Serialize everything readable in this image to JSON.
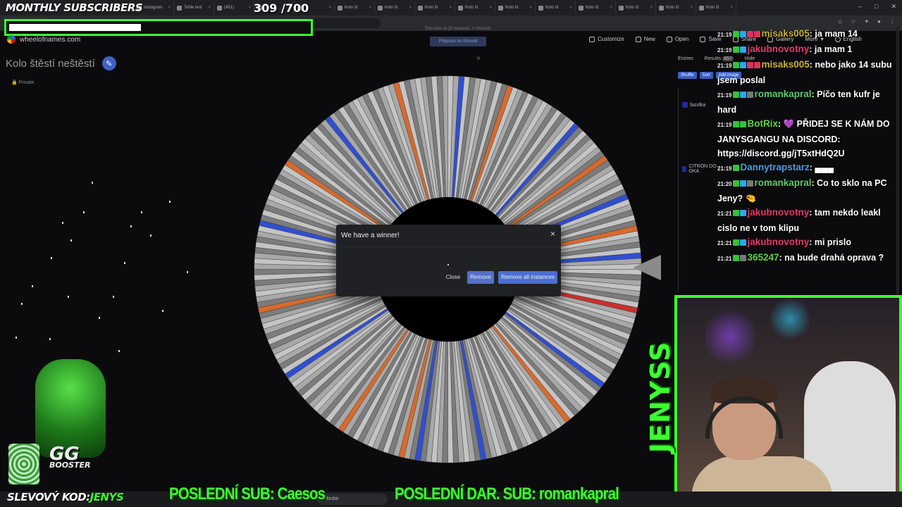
{
  "browser": {
    "tabs": [
      "Instagram",
      "Tohle test",
      "(451)",
      "",
      "",
      "Kolo št",
      "Kolo št",
      "Kolo št",
      "Kolo št",
      "Kolo št",
      "Kolo št",
      "Kolo št",
      "Kolo št",
      "Kolo št",
      "Kolo št"
    ],
    "address": "wheelofnames.com",
    "window_controls": [
      "–",
      "□",
      "✕"
    ]
  },
  "overlay": {
    "subs_title": "MONTHLY SUBSCRIBERS",
    "subs_current": "309",
    "subs_goal": "/700",
    "subs_progress": 0.44,
    "discount_label": "SLEVOVÝ KOD:",
    "discount_code": "JENYS",
    "last_sub": "POSLEDNÍ SUB: Caesos",
    "last_gift_sub": "POSLEDNÍ DAR. SUB: romankapral",
    "jenyss": "JENYSS",
    "mascot_text": "GG",
    "mascot_subtext": "BOOSTER"
  },
  "page": {
    "site": "wheelofnames.com",
    "title": "Kolo štěstí neštěstí",
    "privacy": "🔒 Private",
    "toolbar": [
      "Customize",
      "New",
      "Open",
      "Save",
      "Share",
      "Gallery",
      "More",
      "English"
    ],
    "ghost_notice": "Toto kolo se již nespustí. V činnosti.",
    "ghost_button": "Přepnout do činnosti"
  },
  "dialog": {
    "title": "We have a winner!",
    "close_x": "×",
    "close": "Close",
    "remove": "Remove",
    "remove_all": "Remove all instances"
  },
  "entries": {
    "tab_entries": "Entries",
    "tab_results": "Results",
    "count": "857",
    "hide": "Hide",
    "shuffle": "Shuffle",
    "sort": "Sort",
    "add_image": "Add image",
    "items": [
      "fazolka",
      "CITRON DO OKA"
    ]
  },
  "chat": [
    {
      "time": "21:19",
      "badges": [
        "green",
        "blue",
        "red",
        "red"
      ],
      "user": "misaks005",
      "color": "#c9b33a",
      "text": ": ja mam 14"
    },
    {
      "time": "21:19",
      "badges": [
        "green",
        "blue"
      ],
      "user": "jakubnovotny",
      "color": "#e23b6b",
      "text": ": ja mam 1"
    },
    {
      "time": "21:19",
      "badges": [
        "green",
        "blue",
        "red",
        "red"
      ],
      "user": "misaks005",
      "color": "#c9b33a",
      "text": ": nebo jako 14 subu jsem poslal"
    },
    {
      "time": "21:19",
      "badges": [
        "green",
        "blue",
        "gray"
      ],
      "user": "romankapral",
      "color": "#5fc96a",
      "text": ": Píčo ten kufr je hard"
    },
    {
      "time": "21:19",
      "badges": [
        "green",
        "green"
      ],
      "user": "BotRix",
      "color": "#5fd34a",
      "text": ": 💜 PŘIDEJ SE K NÁM DO JANYSGANGU NA DISCORD: https://discord.gg/jT5xtHdQ2U"
    },
    {
      "time": "21:19",
      "badges": [
        "green"
      ],
      "user": "Dannytrapstarz",
      "color": "#4e9de0",
      "text": ": ▄▄▄"
    },
    {
      "time": "21:20",
      "badges": [
        "green",
        "blue",
        "gray"
      ],
      "user": "romankapral",
      "color": "#5fc96a",
      "text": ": Co to sklo na PC Jeny? 🤏"
    },
    {
      "time": "21:21",
      "badges": [
        "green",
        "blue"
      ],
      "user": "jakubnovotny",
      "color": "#e23b6b",
      "text": ": tam nekdo leakl cislo ne v tom klipu"
    },
    {
      "time": "21:21",
      "badges": [
        "green",
        "blue"
      ],
      "user": "jakubnovotny",
      "color": "#e23b6b",
      "text": ": mi prislo"
    },
    {
      "time": "21:21",
      "badges": [
        "green",
        "gray"
      ],
      "user": "365247",
      "color": "#5fd34a",
      "text": ": na bude drahá oprava ?"
    }
  ],
  "taskbar": {
    "search": "Hledat"
  },
  "colors": {
    "accent_green": "#3cff2f",
    "wheel_blue": "#2f4fd0",
    "wheel_orange": "#d86a2c",
    "wheel_red": "#c8302a",
    "dialog_button": "#4a6fd0"
  }
}
